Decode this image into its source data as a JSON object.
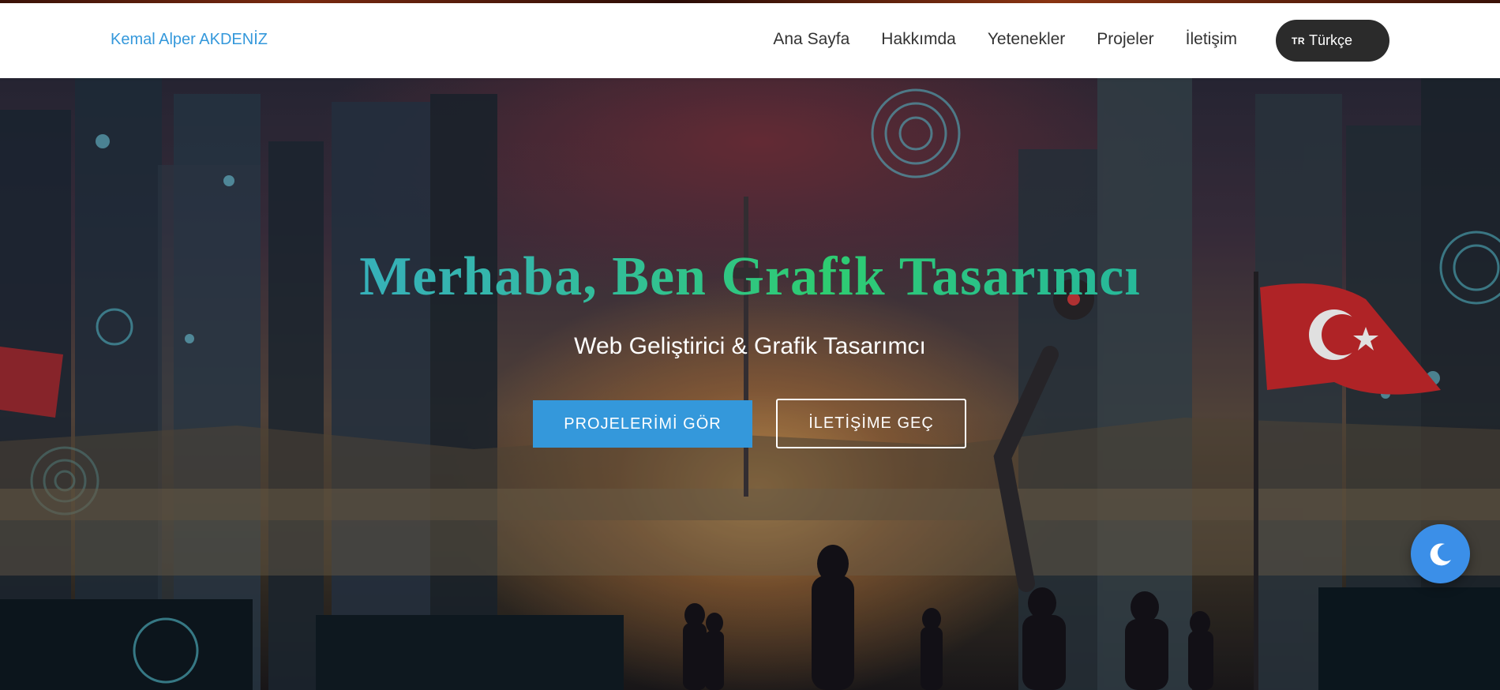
{
  "header": {
    "brand": "Kemal Alper AKDENİZ",
    "nav": [
      {
        "label": "Ana Sayfa"
      },
      {
        "label": "Hakkımda"
      },
      {
        "label": "Yetenekler"
      },
      {
        "label": "Projeler"
      },
      {
        "label": "İletişim"
      }
    ],
    "language": {
      "code": "TR",
      "label": "Türkçe"
    }
  },
  "hero": {
    "title": "Merhaba, Ben Grafik Tasarımcı",
    "subtitle": "Web Geliştirici & Grafik Tasarımcı",
    "primary_button": "PROJELERİMİ GÖR",
    "secondary_button": "İLETİŞİME GEÇ"
  },
  "theme_toggle": {
    "icon": "moon-icon"
  },
  "colors": {
    "accent": "#3498db",
    "nav_text": "#333333",
    "lang_button": "#2b2b2b",
    "theme_toggle": "#3b8fe8"
  }
}
